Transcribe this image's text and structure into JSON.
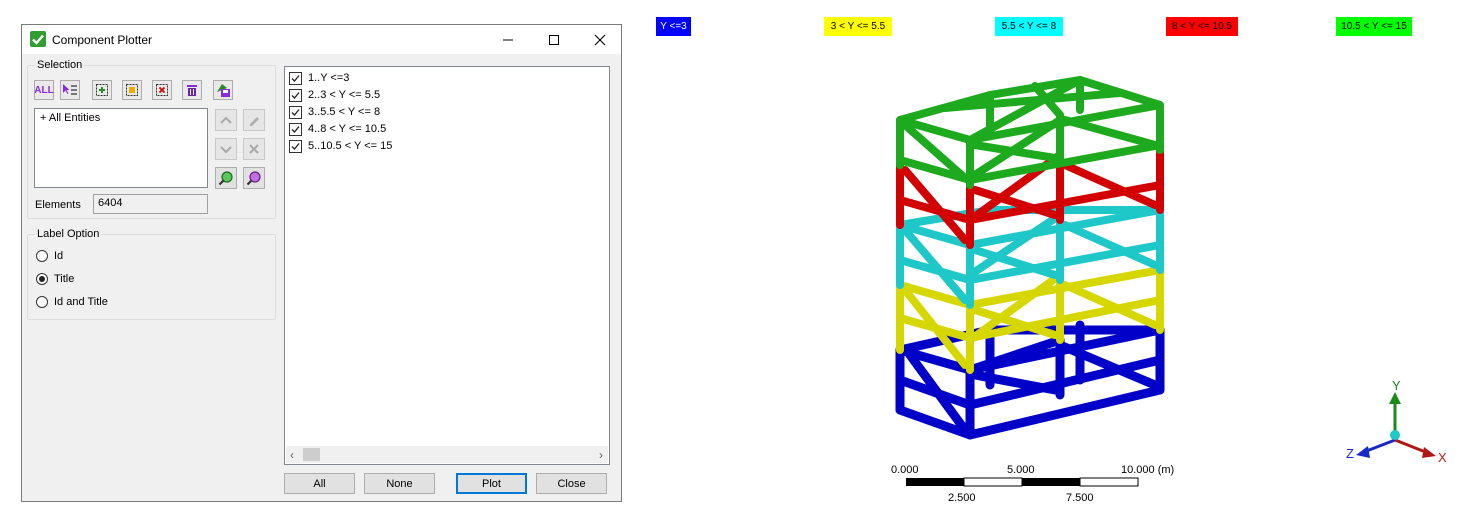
{
  "dialog": {
    "title": "Component Plotter",
    "icons": {
      "app": "checkmark-icon",
      "minimize": "minimize-icon",
      "maximize": "maximize-icon",
      "close": "close-icon"
    },
    "selection": {
      "label": "Selection",
      "toolbar": [
        {
          "name": "select-all-icon",
          "text": "ALL"
        },
        {
          "name": "pick-list-icon"
        },
        {
          "name": "add-selection-icon"
        },
        {
          "name": "box-selection-icon"
        },
        {
          "name": "remove-selection-icon"
        },
        {
          "name": "delete-icon"
        },
        {
          "name": "save-selection-icon"
        }
      ],
      "entities": [
        "+ All Entities"
      ],
      "side_buttons": [
        "move-up-icon",
        "edit-icon",
        "move-down-icon",
        "clear-icon",
        "zoom-icon",
        "zoom-selected-icon"
      ],
      "elements_label": "Elements",
      "elements_value": "6404"
    },
    "label_option": {
      "label": "Label Option",
      "options": [
        "Id",
        "Title",
        "Id and Title"
      ],
      "selected": "Title"
    },
    "components": [
      {
        "label": "1..Y <=3",
        "checked": true
      },
      {
        "label": "2..3 < Y <= 5.5",
        "checked": true
      },
      {
        "label": "3..5.5 < Y <= 8",
        "checked": true
      },
      {
        "label": "4..8 < Y <= 10.5",
        "checked": true
      },
      {
        "label": "5..10.5 < Y <= 15",
        "checked": true
      }
    ],
    "buttons": {
      "all": "All",
      "none": "None",
      "plot": "Plot",
      "close": "Close"
    }
  },
  "viewer": {
    "legend": [
      {
        "label": "Y <=3",
        "color": "#0000ff",
        "text_color": "#ffffff"
      },
      {
        "label": "3 < Y <= 5.5",
        "color": "#ffff00",
        "text_color": "#000000"
      },
      {
        "label": "5.5 < Y <= 8",
        "color": "#00ffff",
        "text_color": "#000000"
      },
      {
        "label": "8 < Y <= 10.5",
        "color": "#ff0000",
        "text_color": "#000000"
      },
      {
        "label": "10.5 < Y <= 15",
        "color": "#00ff00",
        "text_color": "#000000"
      }
    ],
    "scale_bar": {
      "top_labels": [
        "0.000",
        "5.000",
        "10.000 (m)"
      ],
      "bottom_labels": [
        "2.500",
        "7.500"
      ]
    },
    "triad": {
      "x": "X",
      "y": "Y",
      "z": "Z"
    }
  }
}
